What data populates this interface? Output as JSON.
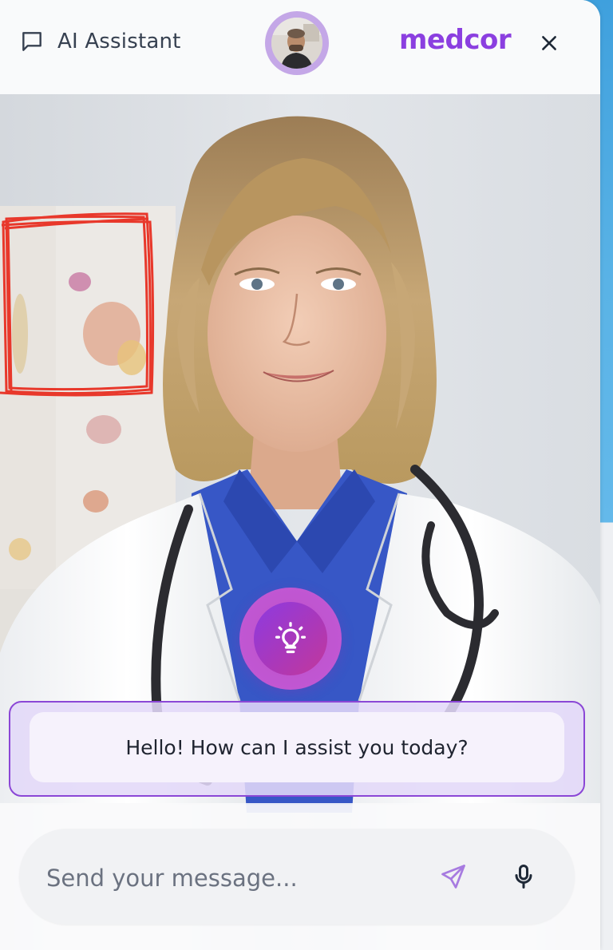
{
  "header": {
    "title": "AI Assistant",
    "brand": "medcor"
  },
  "greeting": {
    "text": "Hello! How can I assist you today?"
  },
  "composer": {
    "placeholder": "Send your message..."
  },
  "icons": {
    "chat": "chat-bubble-icon",
    "close": "close-icon",
    "bulb": "lightbulb-icon",
    "send": "send-icon",
    "mic": "microphone-icon"
  },
  "colors": {
    "brand": "#8b3fe0",
    "accent_border": "#8b47d6",
    "avatar_ring": "#c4a7e7",
    "scribble": "#e8382b"
  }
}
